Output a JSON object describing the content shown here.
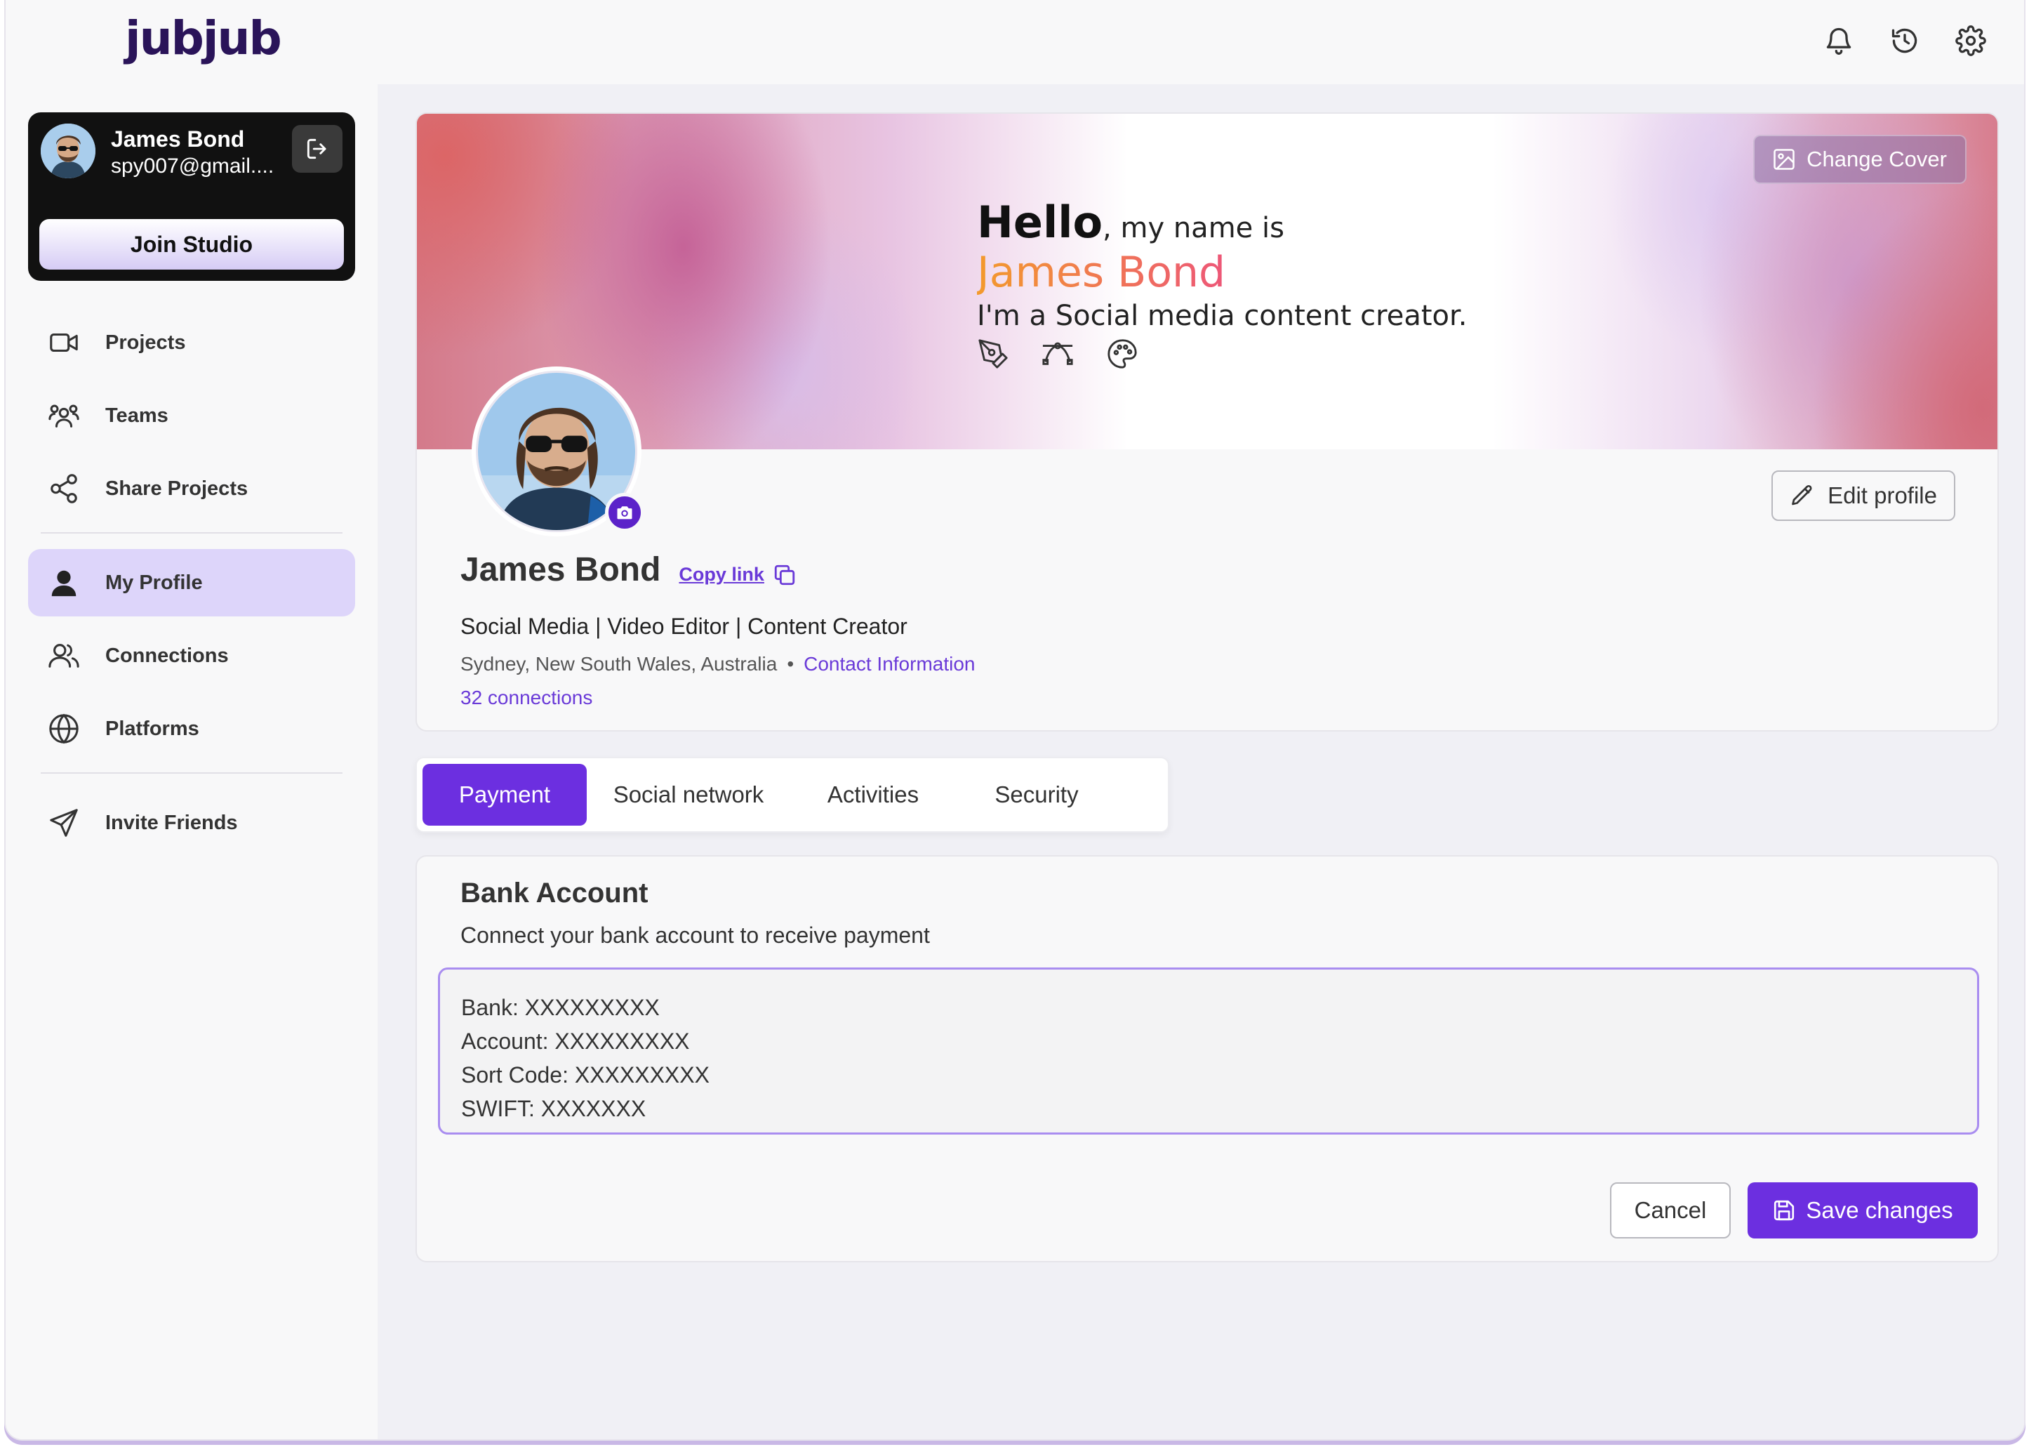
{
  "app": {
    "logo": "jubjub"
  },
  "header": {
    "icons": [
      "bell-icon",
      "history-icon",
      "gear-icon"
    ]
  },
  "sidebar": {
    "user": {
      "name": "James Bond",
      "email": "spy007@gmail...."
    },
    "join_label": "Join Studio",
    "items": [
      {
        "label": "Projects",
        "icon": "video-icon"
      },
      {
        "label": "Teams",
        "icon": "teams-icon"
      },
      {
        "label": "Share Projects",
        "icon": "share-icon"
      },
      {
        "label": "My Profile",
        "icon": "user-icon",
        "active": true
      },
      {
        "label": "Connections",
        "icon": "connections-icon"
      },
      {
        "label": "Platforms",
        "icon": "globe-icon"
      },
      {
        "label": "Invite Friends",
        "icon": "send-icon"
      }
    ]
  },
  "cover": {
    "hello": "Hello",
    "hello_rest": ", my name is",
    "name": "James Bond",
    "tagline": "I'm a Social media content creator.",
    "change_cover_label": "Change Cover",
    "accent_gradient": [
      "#f39a2c",
      "#ec4a86",
      "#d62ad2"
    ]
  },
  "profile": {
    "name": "James Bond",
    "copy_link_label": "Copy link",
    "edit_label": "Edit profile",
    "title": "Social Media | Video Editor | Content Creator",
    "location": "Sydney, New South Wales, Australia",
    "separator": "•",
    "contact_label": "Contact Information",
    "connections_label": "32 connections"
  },
  "tabs": [
    {
      "label": "Payment",
      "active": true
    },
    {
      "label": "Social network"
    },
    {
      "label": "Activities"
    },
    {
      "label": "Security"
    }
  ],
  "bank": {
    "title": "Bank Account",
    "subtitle": "Connect your bank account to receive payment",
    "lines": [
      "Bank: XXXXXXXXX",
      "Account: XXXXXXXXX",
      "Sort Code: XXXXXXXXX",
      "SWIFT: XXXXXXX"
    ],
    "cancel_label": "Cancel",
    "save_label": "Save changes"
  },
  "colors": {
    "accent": "#6c2fe0",
    "active_nav": "#ddd5fa",
    "link": "#6a3ad8"
  }
}
